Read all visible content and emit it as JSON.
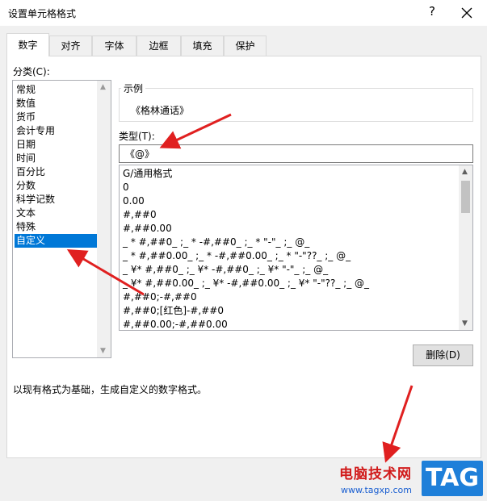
{
  "window": {
    "title": "设置单元格格式",
    "help_glyph": "?",
    "close_icon": "close-icon"
  },
  "tabs": [
    "数字",
    "对齐",
    "字体",
    "边框",
    "填充",
    "保护"
  ],
  "active_tab": "数字",
  "category": {
    "label": "分类(C):",
    "items": [
      "常规",
      "数值",
      "货币",
      "会计专用",
      "日期",
      "时间",
      "百分比",
      "分数",
      "科学记数",
      "文本",
      "特殊",
      "自定义"
    ],
    "selected": "自定义"
  },
  "sample": {
    "legend": "示例",
    "value": "《格林通话》"
  },
  "type": {
    "label": "类型(T):",
    "value": "《@》"
  },
  "formats": [
    "G/通用格式",
    "0",
    "0.00",
    "#,##0",
    "#,##0.00",
    "_ * #,##0_ ;_ * -#,##0_ ;_ * \"-\"_ ;_ @_",
    "_ * #,##0.00_ ;_ * -#,##0.00_ ;_ * \"-\"??_ ;_ @_",
    "_ ¥* #,##0_ ;_ ¥* -#,##0_ ;_ ¥* \"-\"_ ;_ @_",
    "_ ¥* #,##0.00_ ;_ ¥* -#,##0.00_ ;_ ¥* \"-\"??_ ;_ @_",
    "#,##0;-#,##0",
    "#,##0;[红色]-#,##0",
    "#,##0.00;-#,##0.00"
  ],
  "delete_button": "删除(D)",
  "description": "以现有格式为基础，生成自定义的数字格式。",
  "watermark": {
    "site": "电脑技术网",
    "url": "www.tagxp.com",
    "logo": "TAG"
  },
  "colors": {
    "selection": "#0078d7",
    "annotation_arrow": "#e02020",
    "watermark_red": "#d11a1a",
    "watermark_blue": "#1e7fd9"
  }
}
